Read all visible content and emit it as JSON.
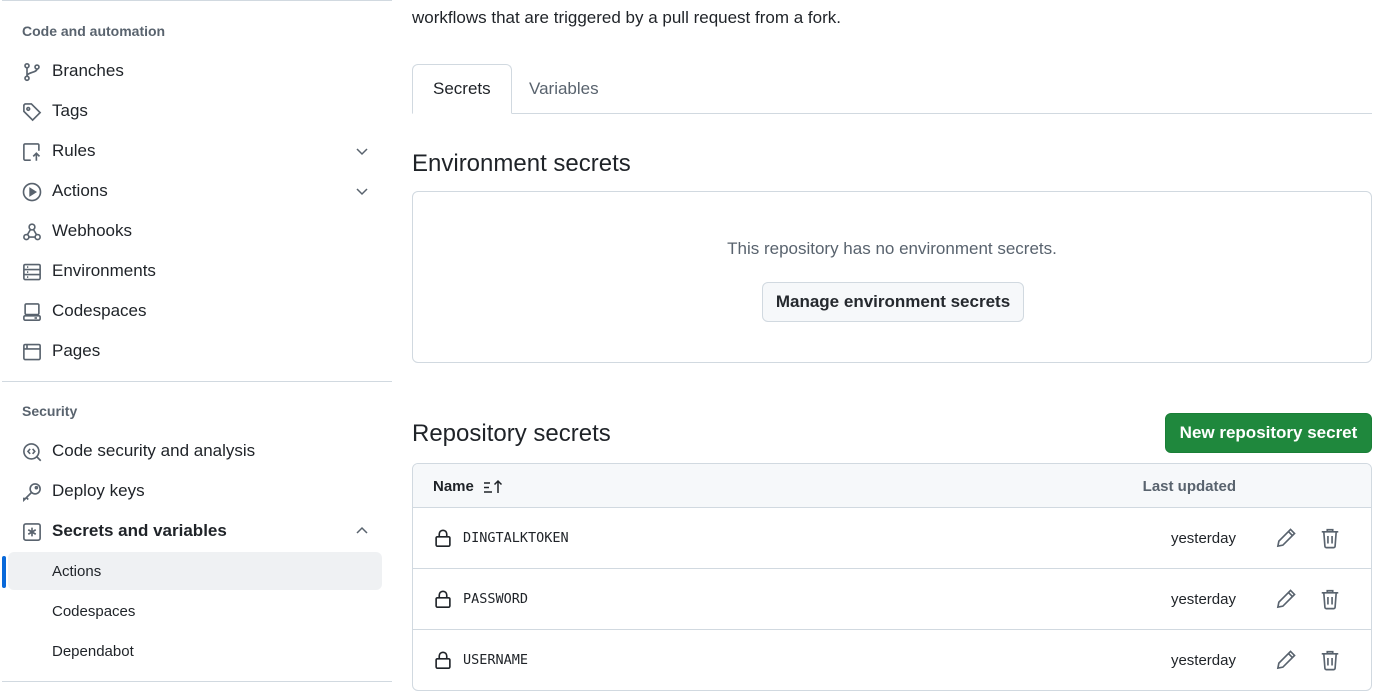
{
  "sidebar": {
    "code_heading": "Code and automation",
    "code_items": [
      {
        "label": "Branches",
        "icon": "branch-icon"
      },
      {
        "label": "Tags",
        "icon": "tag-icon"
      },
      {
        "label": "Rules",
        "icon": "rules-icon",
        "expandable": true
      },
      {
        "label": "Actions",
        "icon": "play-icon",
        "expandable": true
      },
      {
        "label": "Webhooks",
        "icon": "webhook-icon"
      },
      {
        "label": "Environments",
        "icon": "server-icon"
      },
      {
        "label": "Codespaces",
        "icon": "codespaces-icon"
      },
      {
        "label": "Pages",
        "icon": "browser-icon"
      }
    ],
    "security_heading": "Security",
    "security_items": [
      {
        "label": "Code security and analysis",
        "icon": "codescan-icon"
      },
      {
        "label": "Deploy keys",
        "icon": "key-icon"
      },
      {
        "label": "Secrets and variables",
        "icon": "asterisk-icon",
        "expanded": true
      }
    ],
    "sub_items": [
      {
        "label": "Actions",
        "active": true
      },
      {
        "label": "Codespaces"
      },
      {
        "label": "Dependabot"
      }
    ]
  },
  "main": {
    "intro_line": "workflows that are triggered by a pull request from a fork.",
    "tabs": [
      {
        "label": "Secrets",
        "selected": true
      },
      {
        "label": "Variables"
      }
    ],
    "environment": {
      "title": "Environment secrets",
      "empty_message": "This repository has no environment secrets.",
      "manage_button": "Manage environment secrets"
    },
    "repository": {
      "title": "Repository secrets",
      "new_button": "New repository secret",
      "columns": {
        "name": "Name",
        "last_updated": "Last updated"
      },
      "secrets": [
        {
          "name": "DINGTALKTOKEN",
          "last_updated": "yesterday"
        },
        {
          "name": "PASSWORD",
          "last_updated": "yesterday"
        },
        {
          "name": "USERNAME",
          "last_updated": "yesterday"
        }
      ]
    }
  },
  "colors": {
    "accent": "#0969da",
    "primary_button": "#1f883d",
    "border": "#d1d9e0",
    "muted_text": "#59636e"
  }
}
